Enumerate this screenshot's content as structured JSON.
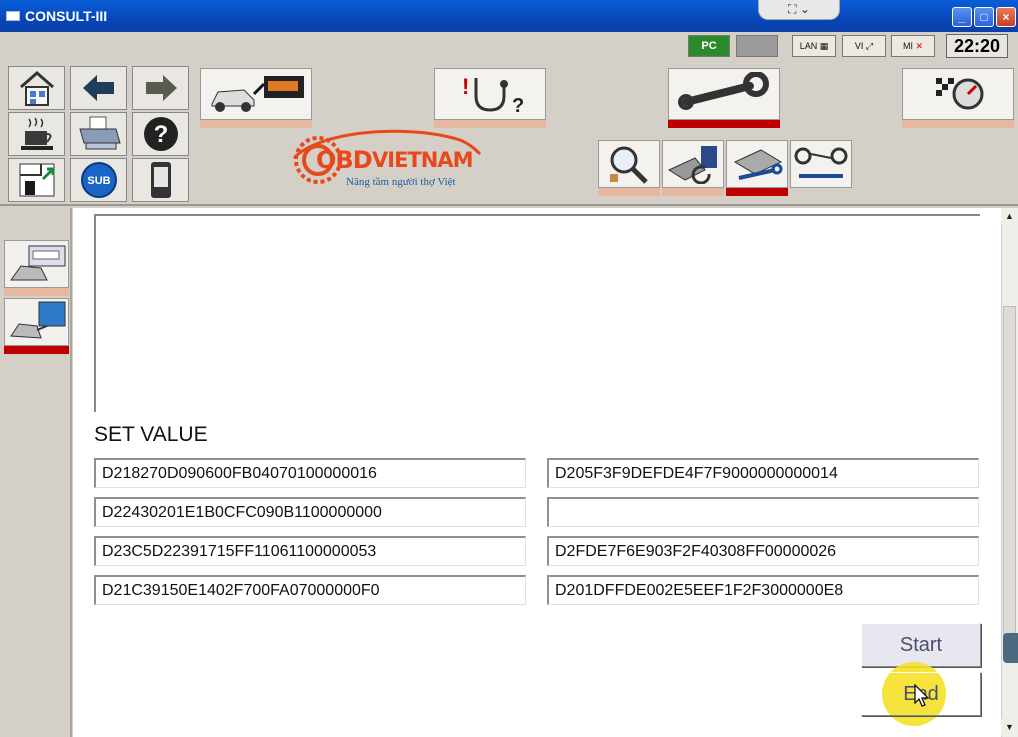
{
  "window": {
    "title": "CONSULT-III",
    "clock": "22:20"
  },
  "status": {
    "pc_label": "PC",
    "lan_label": "LAN",
    "vi_label": "VI",
    "mi_label": "MI"
  },
  "toolbar": {
    "nav_icons": [
      "home-icon",
      "back-arrow-icon",
      "forward-arrow-icon",
      "coffee-icon",
      "printer-icon",
      "help-icon",
      "screen-capture-icon",
      "sub-icon",
      "device-icon"
    ],
    "sub_label": "SUB",
    "help_label": "?",
    "tabs": [
      "vehicle-connect-tab",
      "diagnosis-tab",
      "repair-tab",
      "reprogramming-tab"
    ],
    "active_tab": "repair-tab",
    "subtabs": [
      "inspection-subtab",
      "ecu-data-subtab",
      "ecu-programming-subtab",
      "parts-config-subtab"
    ],
    "active_subtab": "ecu-programming-subtab"
  },
  "logo": {
    "brand": "OBDVIETNAM",
    "brand_prefix": "OBD",
    "brand_suffix": "VIETNAM",
    "slogan": "Nâng tầm người thợ Việt"
  },
  "main": {
    "set_value_label": "SET VALUE",
    "values_left": [
      "D218270D090600FB04070100000016",
      "D22430201E1B0CFC090B1100000000",
      "D23C5D22391715FF11061100000053",
      "D21C39150E1402F700FA07000000F0"
    ],
    "values_right": [
      "D205F3F9DEFDE4F7F9000000000014",
      "",
      "D2FDE7F6E903F2F40308FF00000026",
      "D201DFFDE002E5EEF1F2F3000000E8"
    ],
    "start_label": "Start",
    "end_label": "End"
  },
  "colors": {
    "titlebar": "#0846b8",
    "active_indicator": "#c00000",
    "inactive_indicator": "#e6b8a0",
    "logo_orange": "#e8491c"
  }
}
